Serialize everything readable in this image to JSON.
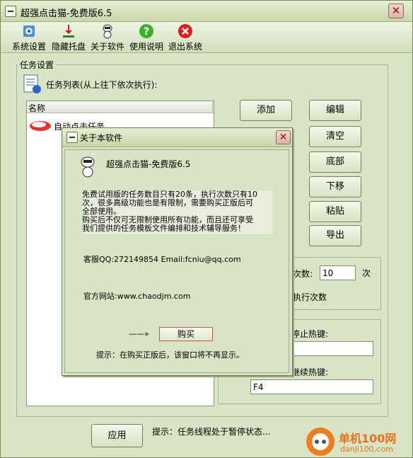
{
  "window": {
    "title": "超强点击猫-免费版6.5"
  },
  "toolbar": {
    "items": [
      {
        "label": "系统设置",
        "icon": "settings-gear-icon"
      },
      {
        "label": "隐藏托盘",
        "icon": "tray-download-icon"
      },
      {
        "label": "关于软件",
        "icon": "robot-cat-icon"
      },
      {
        "label": "使用说明",
        "icon": "help-question-icon"
      },
      {
        "label": "退出系统",
        "icon": "exit-x-icon"
      }
    ]
  },
  "task": {
    "group_label": "任务设置",
    "list_label": "任务列表(从上往下依次执行):",
    "column_name": "名称",
    "items": [
      "自动点击任务"
    ]
  },
  "buttons": {
    "add": "添加",
    "edit": "编辑",
    "clear": "清空",
    "bottom": "底部",
    "down": "下移",
    "paste": "粘贴",
    "export": "导出",
    "apply": "应用"
  },
  "exec": {
    "count_label": "次数:",
    "count_value": "10",
    "unit": "次",
    "exec_count_label": "执行次数"
  },
  "hotkeys": {
    "stop_label": "停止热键:",
    "stop_value": "",
    "resume_label": "继续热键:",
    "resume_value": "F4"
  },
  "status": {
    "message": "提示：任务线程处于暂停状态..."
  },
  "about": {
    "title": "关于本软件",
    "app_name": "超强点击猫-免费版6.5",
    "notice_lines": [
      "免费试用版的任务数目只有20条，执行次数只有10",
      "次，很多高级功能也是有限制，需要购买正版后可",
      "全部使用。",
      "购买后不仅可无限制使用所有功能，而且还可享受",
      "我们提供的任务模板文件编排和技术辅导服务！"
    ],
    "contact": "客服QQ:272149854   Email:fcniu@qq.com",
    "website": "官方网站:www.chaodjm.com",
    "arrow": "——»",
    "buy_label": "购买",
    "tip": "提示：在购买正版后，该窗口将不再显示。"
  },
  "watermark": {
    "name": "单机100网",
    "url": "danji100.com"
  },
  "colors": {
    "window_bg": "#d9e4c5",
    "accent_close": "#a01010",
    "watermark": "#e8731c"
  }
}
